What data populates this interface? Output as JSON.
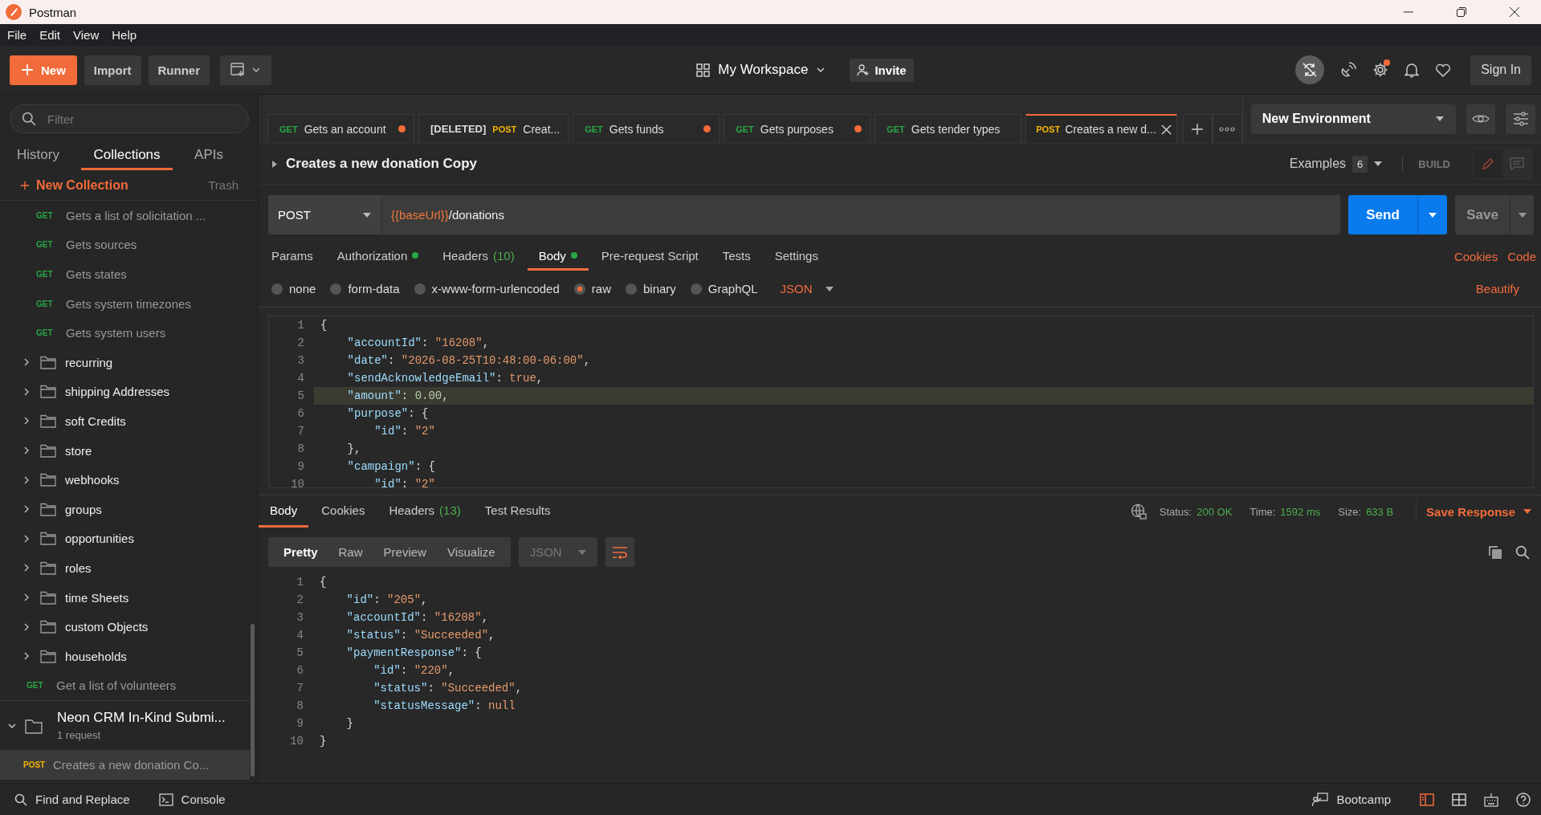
{
  "window": {
    "title": "Postman"
  },
  "menu": [
    "File",
    "Edit",
    "View",
    "Help"
  ],
  "header": {
    "new_button": "New",
    "import_button": "Import",
    "runner_button": "Runner",
    "workspace": "My Workspace",
    "invite_button": "Invite",
    "settings_notification": true,
    "sign_in_button": "Sign In"
  },
  "sidebar": {
    "filter": {
      "placeholder": "Filter"
    },
    "tabs": [
      {
        "label": "History",
        "selected": false
      },
      {
        "label": "Collections",
        "selected": true
      },
      {
        "label": "APIs",
        "selected": false
      }
    ],
    "new_collection": "New Collection",
    "trash": "Trash",
    "tree": [
      {
        "kind": "collection",
        "children": [
          {
            "kind": "folder",
            "children": [
              {
                "kind": "request",
                "method": "GET",
                "color": "#28a745",
                "name": "Gets a list of solicitation ...",
                "selected": false
              },
              {
                "kind": "request",
                "method": "GET",
                "color": "#28a745",
                "name": "Gets sources",
                "selected": false
              },
              {
                "kind": "request",
                "method": "GET",
                "color": "#28a745",
                "name": "Gets states",
                "selected": false
              },
              {
                "kind": "request",
                "method": "GET",
                "color": "#28a745",
                "name": "Gets system timezones",
                "selected": false
              },
              {
                "kind": "request",
                "method": "GET",
                "color": "#28a745",
                "name": "Gets system users",
                "selected": false
              }
            ]
          },
          {
            "kind": "folder",
            "name": "recurring",
            "expanded": false
          },
          {
            "kind": "folder",
            "name": "shipping Addresses",
            "expanded": false
          },
          {
            "kind": "folder",
            "name": "soft Credits",
            "expanded": false
          },
          {
            "kind": "folder",
            "name": "store",
            "expanded": false
          },
          {
            "kind": "folder",
            "name": "webhooks",
            "expanded": false
          },
          {
            "kind": "folder",
            "name": "groups",
            "expanded": false
          },
          {
            "kind": "folder",
            "name": "opportunities",
            "expanded": false
          },
          {
            "kind": "folder",
            "name": "roles",
            "expanded": false
          },
          {
            "kind": "folder",
            "name": "time Sheets",
            "expanded": false
          },
          {
            "kind": "folder",
            "name": "custom Objects",
            "expanded": false
          },
          {
            "kind": "folder",
            "name": "households",
            "expanded": false
          },
          {
            "kind": "request",
            "method": "GET",
            "color": "#28a745",
            "name": "Get a list of volunteers",
            "selected": false
          }
        ]
      },
      {
        "kind": "collection",
        "name": "Neon CRM In-Kind Submi...",
        "count": "1 request",
        "expanded": true,
        "children": [
          {
            "kind": "request",
            "method": "POST",
            "color": "#f4b400",
            "name": "Creates a new donation Co...",
            "selected": true
          }
        ]
      }
    ]
  },
  "tabs": [
    {
      "method": "GET",
      "color": "#28a745",
      "name": "Gets an account",
      "modified": true,
      "selected": false
    },
    {
      "prefix": "[DELETED]",
      "method": "POST",
      "color": "#f4b400",
      "name": "Creat...",
      "modified": false,
      "selected": false
    },
    {
      "method": "GET",
      "color": "#28a745",
      "name": "Gets funds",
      "modified": true,
      "selected": false
    },
    {
      "method": "GET",
      "color": "#28a745",
      "name": "Gets purposes",
      "modified": true,
      "selected": false
    },
    {
      "method": "GET",
      "color": "#28a745",
      "name": "Gets tender types",
      "modified": false,
      "selected": false
    },
    {
      "method": "POST",
      "color": "#f4b400",
      "name": "Creates a new d...",
      "modified": false,
      "selected": true
    }
  ],
  "environment": "New Environment",
  "request": {
    "title": "Creates a new donation Copy",
    "examples_label": "Examples",
    "examples_count": "6",
    "build_label": "BUILD",
    "method": "POST",
    "url_variable": "{{baseUrl}}",
    "url_path": "/donations",
    "send_button": "Send",
    "save_button": "Save",
    "tabs": [
      {
        "label": "Params",
        "dot": false,
        "selected": false
      },
      {
        "label": "Authorization",
        "dot": true,
        "selected": false
      },
      {
        "label": "Headers",
        "count": "(10)",
        "dot": false,
        "selected": false
      },
      {
        "label": "Body",
        "dot": true,
        "selected": true
      },
      {
        "label": "Pre-request Script",
        "dot": false,
        "selected": false
      },
      {
        "label": "Tests",
        "dot": false,
        "selected": false
      },
      {
        "label": "Settings",
        "dot": false,
        "selected": false
      }
    ],
    "links": [
      "Cookies",
      "Code"
    ],
    "body_modes": [
      {
        "label": "none",
        "selected": false
      },
      {
        "label": "form-data",
        "selected": false
      },
      {
        "label": "x-www-form-urlencoded",
        "selected": false
      },
      {
        "label": "raw",
        "selected": true
      },
      {
        "label": "binary",
        "selected": false
      },
      {
        "label": "GraphQL",
        "selected": false
      }
    ],
    "body_format": "JSON",
    "beautify": "Beautify",
    "lines": [
      {
        "n": "1",
        "highlighted": false,
        "tokens": [
          {
            "text": "{",
            "kind": "punct"
          }
        ]
      },
      {
        "n": "2",
        "highlighted": false,
        "tokens": [
          {
            "text": "    \"accountId\"",
            "kind": "key"
          },
          {
            "text": ": ",
            "kind": "punct"
          },
          {
            "text": "\"16208\"",
            "kind": "str"
          },
          {
            "text": ",",
            "kind": "punct"
          }
        ]
      },
      {
        "n": "3",
        "highlighted": false,
        "tokens": [
          {
            "text": "    \"date\"",
            "kind": "key"
          },
          {
            "text": ": ",
            "kind": "punct"
          },
          {
            "text": "\"2026-08-25T10:48:00-06:00\"",
            "kind": "str"
          },
          {
            "text": ",",
            "kind": "punct"
          }
        ]
      },
      {
        "n": "4",
        "highlighted": false,
        "tokens": [
          {
            "text": "    \"sendAcknowledgeEmail\"",
            "kind": "key"
          },
          {
            "text": ": ",
            "kind": "punct"
          },
          {
            "text": "true",
            "kind": "lit"
          },
          {
            "text": ",",
            "kind": "punct"
          }
        ]
      },
      {
        "n": "5",
        "highlighted": true,
        "tokens": [
          {
            "text": "    \"amount\"",
            "kind": "key"
          },
          {
            "text": ": ",
            "kind": "punct"
          },
          {
            "text": "0.00",
            "kind": "num"
          },
          {
            "text": ",",
            "kind": "punct"
          }
        ]
      },
      {
        "n": "6",
        "highlighted": false,
        "tokens": [
          {
            "text": "    \"purpose\"",
            "kind": "key"
          },
          {
            "text": ": {",
            "kind": "punct"
          }
        ]
      },
      {
        "n": "7",
        "highlighted": false,
        "tokens": [
          {
            "text": "        \"id\"",
            "kind": "key"
          },
          {
            "text": ": ",
            "kind": "punct"
          },
          {
            "text": "\"2\"",
            "kind": "str"
          }
        ]
      },
      {
        "n": "8",
        "highlighted": false,
        "tokens": [
          {
            "text": "    },",
            "kind": "punct"
          }
        ]
      },
      {
        "n": "9",
        "highlighted": false,
        "tokens": [
          {
            "text": "    \"campaign\"",
            "kind": "key"
          },
          {
            "text": ": {",
            "kind": "punct"
          }
        ]
      },
      {
        "n": "10",
        "highlighted": false,
        "tokens": [
          {
            "text": "        \"id\"",
            "kind": "key"
          },
          {
            "text": ": ",
            "kind": "punct"
          },
          {
            "text": "\"2\"",
            "kind": "str"
          }
        ]
      }
    ]
  },
  "response": {
    "tabs": [
      {
        "label": "Body",
        "selected": true
      },
      {
        "label": "Cookies",
        "selected": false
      },
      {
        "label": "Headers",
        "count": "(13)",
        "selected": false
      },
      {
        "label": "Test Results",
        "selected": false
      }
    ],
    "status_label": "Status:",
    "status": "200 OK",
    "time_label": "Time:",
    "time": "1592 ms",
    "size_label": "Size:",
    "size": "633 B",
    "save_response": "Save Response",
    "views": [
      {
        "label": "Pretty",
        "selected": true
      },
      {
        "label": "Raw",
        "selected": false
      },
      {
        "label": "Preview",
        "selected": false
      },
      {
        "label": "Visualize",
        "selected": false
      }
    ],
    "format": "JSON",
    "wrap": true,
    "lines": [
      {
        "n": "1",
        "tokens": [
          {
            "text": "{",
            "kind": "punct"
          }
        ]
      },
      {
        "n": "2",
        "tokens": [
          {
            "text": "    \"id\"",
            "kind": "key"
          },
          {
            "text": ": ",
            "kind": "punct"
          },
          {
            "text": "\"205\"",
            "kind": "str"
          },
          {
            "text": ",",
            "kind": "punct"
          }
        ]
      },
      {
        "n": "3",
        "tokens": [
          {
            "text": "    \"accountId\"",
            "kind": "key"
          },
          {
            "text": ": ",
            "kind": "punct"
          },
          {
            "text": "\"16208\"",
            "kind": "str"
          },
          {
            "text": ",",
            "kind": "punct"
          }
        ]
      },
      {
        "n": "4",
        "tokens": [
          {
            "text": "    \"status\"",
            "kind": "key"
          },
          {
            "text": ": ",
            "kind": "punct"
          },
          {
            "text": "\"Succeeded\"",
            "kind": "str"
          },
          {
            "text": ",",
            "kind": "punct"
          }
        ]
      },
      {
        "n": "5",
        "tokens": [
          {
            "text": "    \"paymentResponse\"",
            "kind": "key"
          },
          {
            "text": ": {",
            "kind": "punct"
          }
        ]
      },
      {
        "n": "6",
        "tokens": [
          {
            "text": "        \"id\"",
            "kind": "key"
          },
          {
            "text": ": ",
            "kind": "punct"
          },
          {
            "text": "\"220\"",
            "kind": "str"
          },
          {
            "text": ",",
            "kind": "punct"
          }
        ]
      },
      {
        "n": "7",
        "tokens": [
          {
            "text": "        \"status\"",
            "kind": "key"
          },
          {
            "text": ": ",
            "kind": "punct"
          },
          {
            "text": "\"Succeeded\"",
            "kind": "str"
          },
          {
            "text": ",",
            "kind": "punct"
          }
        ]
      },
      {
        "n": "8",
        "tokens": [
          {
            "text": "        \"statusMessage\"",
            "kind": "key"
          },
          {
            "text": ": ",
            "kind": "punct"
          },
          {
            "text": "null",
            "kind": "lit"
          }
        ]
      },
      {
        "n": "9",
        "tokens": [
          {
            "text": "    }",
            "kind": "punct"
          }
        ]
      },
      {
        "n": "10",
        "tokens": [
          {
            "text": "}",
            "kind": "punct"
          }
        ]
      }
    ]
  },
  "footer": {
    "find_replace": "Find and Replace",
    "console": "Console",
    "bootcamp": "Bootcamp"
  }
}
